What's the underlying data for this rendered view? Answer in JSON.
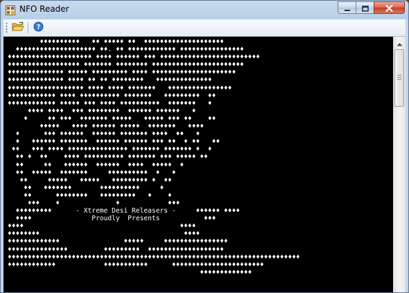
{
  "window": {
    "title": "NFO Reader"
  },
  "icons": {
    "app": "nfo-reader-app-icon",
    "minimize": "minimize-icon",
    "maximize": "maximize-icon",
    "close": "close-icon",
    "open": "open-folder-icon",
    "help": "help-icon",
    "scroll_up": "scroll-up-arrow-icon"
  },
  "colors": {
    "content_background": "#000000",
    "content_text": "#ffffff",
    "close_button": "#c83d20"
  },
  "nfo": {
    "lines": [
      "        ♦♦♦♦♦♦♦♦♦♦   ♦♦ ♦♦♦♦♦ ♦♦  ♦♦♦♦♦♦♦♦♦♦♦♦♦♦♦♦♦♦♦♦",
      "  ♦♦♦♦♦♦♦♦♦♦♦♦♦♦♦♦♦♦♦♦ ♦♦. ♦♦ ♦♦♦♦♦♦♦♦♦♦♦♦ ♦♦♦♦♦♦♦♦♦♦♦♦♦♦♦♦",
      "♦♦♦♦♦♦♦♦♦♦♦♦♦♦♦♦♦♦♦♦♦ ♦♦♦♦ ♦♦♦♦♦♦ ♦♦♦ ♦♦♦♦♦♦♦♦♦♦♦♦♦♦♦♦♦♦♦♦♦♦♦♦♦",
      "♦♦♦♦♦♦♦♦♦♦♦♦♦♦♦♦♦♦ ♦♦♦♦♦♦♦ ♦♦♦♦♦♦♦♦ ♦♦♦♦♦♦♦♦♦♦♦♦♦♦♦♦♦♦♦♦♦♦♦",
      "♦♦♦♦♦♦♦♦♦♦♦♦♦♦ ♦♦♦♦♦ ♦♦♦♦♦♦♦♦♦ ♦♦♦♦ ♦♦♦♦♦♦♦♦♦♦♦♦♦♦♦♦♦♦♦♦♦",
      "♦♦♦♦♦♦♦♦♦♦♦♦♦♦ ♦♦♦♦ ♦♦ ♦♦ ♦♦♦♦♦♦♦♦   ♦♦♦♦♦♦♦♦♦♦♦♦♦♦",
      "♦♦♦♦♦♦♦♦♦♦♦♦♦♦♦♦♦♦♦ ♦♦♦♦ ♦♦♦♦ ♦♦♦♦♦♦♦   ♦♦♦♦♦♦♦♦♦♦♦♦♦♦♦♦",
      "♦♦♦♦♦♦♦♦♦♦♦♦ ♦♦♦♦ ♦♦♦♦♦♦♦♦♦♦ ♦♦♦♦♦♦♦   ♦♦♦♦♦♦♦♦♦  ♦♦",
      "♦♦♦♦♦♦♦♦♦♦♦♦ ♦♦♦♦♦ ♦♦♦ ♦♦♦♦ ♦♦♦♦♦♦♦♦♦♦  ♦♦♦♦♦♦♦   ♦",
      "     ♦♦♦♦ ♦♦♦♦  ♦♦♦ ♦♦♦♦♦♦♦♦  ♦♦♦♦♦♦ ♦♦♦♦♦♦   ♦",
      "    ♦     ♦♦ ♦♦♦  ♦♦♦♦♦♦♦ ♦♦♦♦♦   ♦♦♦♦♦ ♦♦♦ ♦♦    ♦♦",
      "        ♦♦♦♦♦   ♦♦♦♦ ♦♦♦♦♦♦ ♦♦♦♦♦  ♦♦♦♦♦♦♦   ♦♦♦♦",
      "  ♦      ♦♦♦ ♦♦♦♦♦♦  ♦♦♦♦♦♦ ♦♦♦♦♦♦♦ ♦♦♦♦  ♦♦   ♦",
      "  ♦   ♦♦♦♦♦♦ ♦♦♦♦♦♦♦  ♦♦♦♦♦♦ ♦♦♦♦♦♦ ♦♦♦ ♦♦  ♦ ♦♦   ♦♦",
      " ♦♦   ♦♦♦ ♦♦♦♦ ♦♦♦♦♦♦♦♦♦♦♦♦♦♦♦ ♦♦♦♦♦♦♦ ♦♦♦♦♦♦♦ ♦  ♦",
      "  ♦♦ ♦  ♦♦    ♦♦♦♦ ♦♦♦♦♦♦♦♦♦♦ ♦♦♦♦♦♦♦ ♦♦♦ ♦♦♦♦♦ ♦♦",
      "  ♦♦     ♦♦   ♦♦♦♦♦♦  ♦♦♦♦♦♦  ♦♦♦♦  ♦♦♦♦♦  ♦",
      "  ♦♦  ♦♦♦♦♦  ♦♦♦♦♦♦♦     ♦♦♦♦♦♦♦♦♦♦  ♦   ♦",
      "   ♦♦     ♦♦♦♦♦   ♦♦♦♦♦   ♦♦♦♦♦♦♦♦♦ ♦  ♦♦",
      "    ♦♦   ♦♦♦♦♦♦♦       ♦♦♦♦♦♦♦♦♦♦     ♦",
      "    ♦♦      ♦♦♦♦♦♦♦♦   ♦♦♦♦♦♦♦♦♦   ♦    ♦",
      "     ♦♦♦    ♦              ♦            ♦♦♦",
      "  ♦♦♦♦♦♦♦♦♦      - Xtreme Desi Releasers -     ♦♦♦♦♦♦ ♦♦♦♦",
      "  ♦♦♦♦               Proudly  Presents           ♦♦♦",
      "♦♦♦♦                                       ♦♦♦♦",
      "♦♦♦♦♦♦♦♦                                    ♦♦♦♦",
      "♦♦♦♦♦♦♦♦♦♦♦♦♦                ♦♦♦♦♦     ♦♦♦♦♦♦♦♦♦♦♦♦♦♦♦♦",
      "♦♦♦♦♦♦♦♦♦♦♦♦♦♦♦         ♦♦♦♦♦♦♦♦♦  ♦♦♦♦♦♦♦♦♦♦♦♦♦♦♦♦♦♦♦",
      "♦♦♦♦♦♦♦♦♦♦♦♦♦♦♦♦♦♦♦♦♦♦♦♦♦♦♦♦♦♦♦♦♦♦♦♦♦♦♦♦♦♦♦♦♦♦♦♦♦♦♦♦♦♦♦♦♦♦♦♦♦♦♦♦♦♦♦♦♦♦♦♦♦",
      "♦♦♦♦♦♦♦♦♦♦♦♦            ♦♦♦♦♦♦♦♦♦♦♦      ♦♦♦♦♦♦♦♦♦♦♦♦♦♦♦♦♦♦♦♦♦♦♦",
      "                                                ♦♦♦♦♦♦♦♦♦♦♦♦♦"
    ]
  }
}
